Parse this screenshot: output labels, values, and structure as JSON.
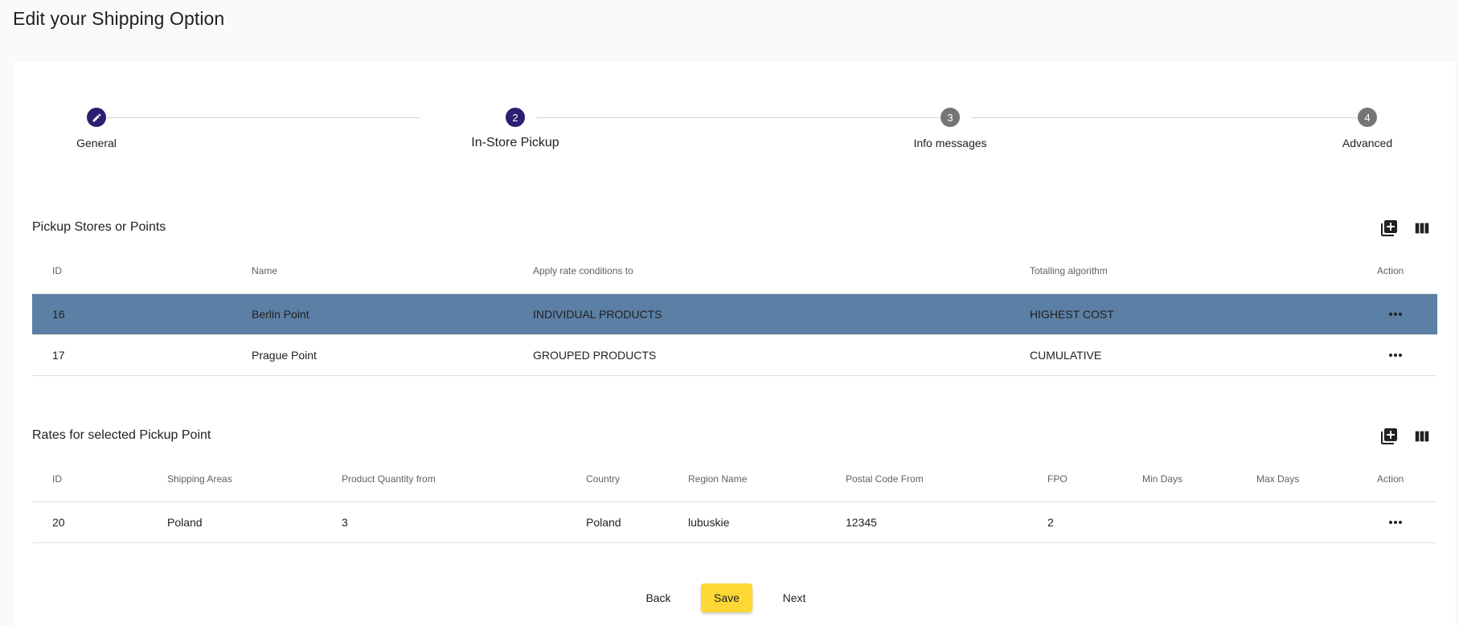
{
  "page": {
    "title": "Edit your Shipping Option"
  },
  "stepper": {
    "steps": [
      {
        "number": "1",
        "label": "General",
        "state": "done",
        "icon": "pencil-icon"
      },
      {
        "number": "2",
        "label": "In-Store Pickup",
        "state": "active"
      },
      {
        "number": "3",
        "label": "Info messages",
        "state": "todo"
      },
      {
        "number": "4",
        "label": "Advanced",
        "state": "todo"
      }
    ]
  },
  "pickup_section": {
    "title": "Pickup Stores or Points",
    "add_icon": "add-box-icon",
    "columns_icon": "view-columns-icon",
    "headers": [
      "ID",
      "Name",
      "Apply rate conditions to",
      "Totalling algorithm",
      "Action"
    ],
    "rows": [
      {
        "id": "16",
        "name": "Berlin Point",
        "apply_to": "INDIVIDUAL PRODUCTS",
        "algorithm": "HIGHEST COST",
        "selected": true
      },
      {
        "id": "17",
        "name": "Prague Point",
        "apply_to": "GROUPED PRODUCTS",
        "algorithm": "CUMULATIVE",
        "selected": false
      }
    ]
  },
  "rates_section": {
    "title": "Rates for selected Pickup Point",
    "add_icon": "add-box-icon",
    "columns_icon": "view-columns-icon",
    "headers": [
      "ID",
      "Shipping Areas",
      "Product Quantity from",
      "Country",
      "Region Name",
      "Postal Code From",
      "FPO",
      "Min Days",
      "Max Days",
      "Action"
    ],
    "rows": [
      {
        "id": "20",
        "shipping_areas": "Poland",
        "quantity_from": "3",
        "country": "Poland",
        "region": "lubuskie",
        "postal_from": "12345",
        "fpo": "2",
        "min_days": "",
        "max_days": ""
      }
    ]
  },
  "actions": {
    "back": "Back",
    "save": "Save",
    "next": "Next"
  },
  "colors": {
    "accent": "#2a1f73",
    "selected_row": "#5c7fa5",
    "save_button": "#fdd835",
    "inactive_step": "#757575"
  }
}
